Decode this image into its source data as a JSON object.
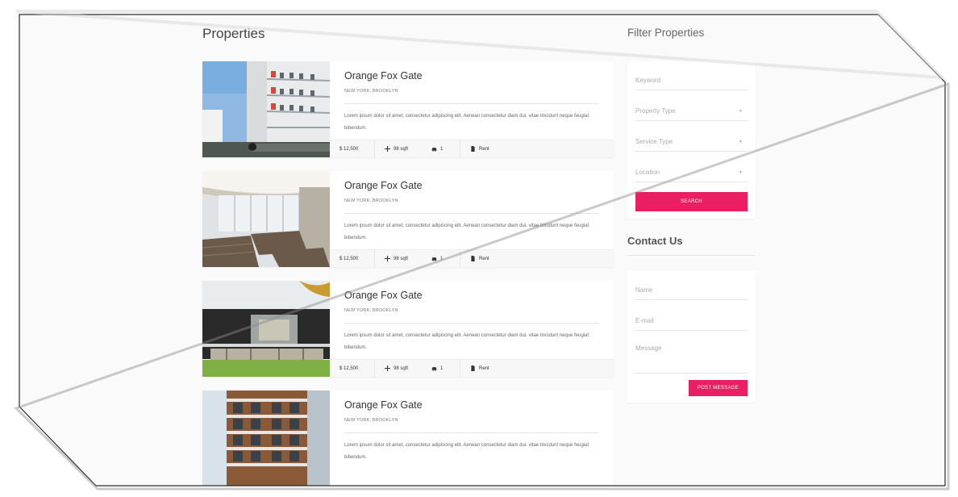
{
  "main": {
    "title": "Properties",
    "listings": [
      {
        "name": "Orange Fox Gate",
        "location": "NEW YORK, BROOKLYN",
        "description": "Lorem ipsum dolor sit amet, consectetur adipiscing elit. Aenean consectetur diam dui, vitae tincidunt neque feugiat bibendum.",
        "price": "$ 12,500",
        "area": "98 sqft",
        "garage": "1",
        "type": "Rent",
        "image_icon": "building-photo"
      },
      {
        "name": "Orange Fox Gate",
        "location": "NEW YORK, BROOKLYN",
        "description": "Lorem ipsum dolor sit amet, consectetur adipiscing elit. Aenean consectetur diam dui, vitae tincidunt neque feugiat bibendum.",
        "price": "$ 12,500",
        "area": "98 sqft",
        "garage": "1",
        "type": "Rent",
        "image_icon": "interior-photo"
      },
      {
        "name": "Orange Fox Gate",
        "location": "NEW YORK, BROOKLYN",
        "description": "Lorem ipsum dolor sit amet, consectetur adipiscing elit. Aenean consectetur diam dui, vitae tincidunt neque feugiat bibendum.",
        "price": "$ 12,500",
        "area": "98 sqft",
        "garage": "1",
        "type": "Rent",
        "image_icon": "modern-house-photo"
      },
      {
        "name": "Orange Fox Gate",
        "location": "NEW YORK, BROOKLYN",
        "description": "Lorem ipsum dolor sit amet, consectetur adipiscing elit. Aenean consectetur diam dui, vitae tincidunt neque feugiat bibendum.",
        "image_icon": "apartment-block-photo"
      }
    ]
  },
  "filter": {
    "title": "Filter Properties",
    "keyword_placeholder": "Keyword",
    "property_type_placeholder": "Property Type",
    "service_type_placeholder": "Service Type",
    "location_placeholder": "Location",
    "search_label": "SEARCH"
  },
  "contact": {
    "title": "Contact Us",
    "name_placeholder": "Name",
    "email_placeholder": "E-mail",
    "message_placeholder": "Message",
    "post_label": "POST MESSAGE"
  },
  "colors": {
    "accent": "#e91e63",
    "background": "#fafafa",
    "card": "#ffffff"
  }
}
